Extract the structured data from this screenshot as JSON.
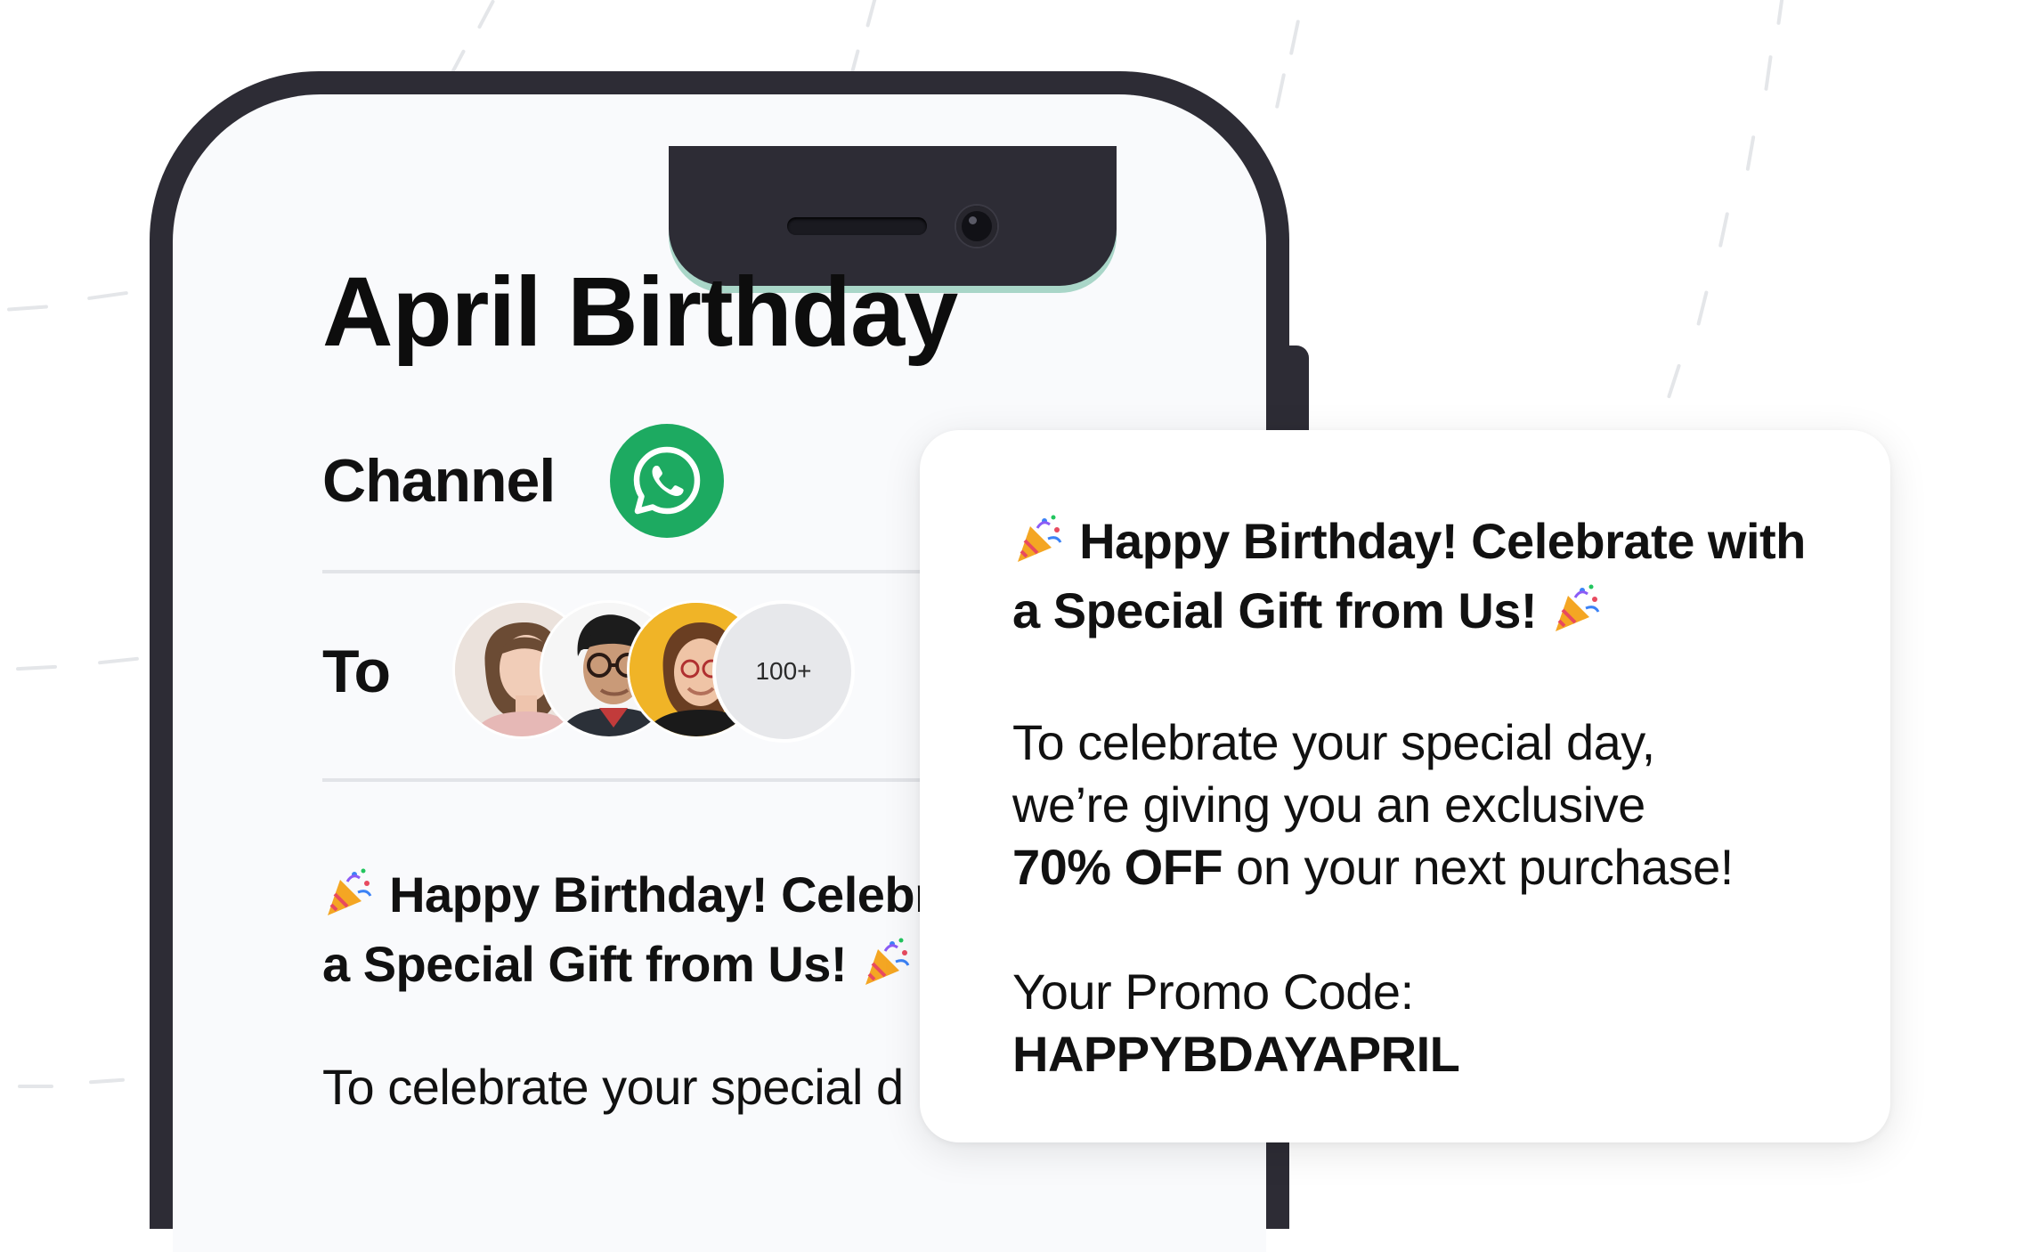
{
  "page": {
    "title": "April Birthday",
    "channel_label": "Channel",
    "channel_icon": "whatsapp-icon",
    "recipients_label": "To",
    "recipients_more": "100+"
  },
  "message": {
    "heading_part1": "Happy Birthday! Celebrate with",
    "heading_part2": "a Special Gift from Us!",
    "preview_heading_part1": "Happy Birthday! Celebr",
    "preview_heading_part2": "a Special Gift from Us!",
    "preview_body_clip": "To celebrate your special d",
    "body_line1": "To celebrate your special day,",
    "body_line2": "we’re giving you an exclusive",
    "discount": "70% OFF",
    "body_line3_rest": " on your next purchase!",
    "promo_label": "Your Promo Code:",
    "promo_code": "HAPPYBDAYAPRIL"
  },
  "colors": {
    "phone_frame": "#2d2c35",
    "screen_bg": "#f9fafc",
    "whatsapp_green": "#1daa61",
    "notch_accent": "#a9d6c8"
  }
}
